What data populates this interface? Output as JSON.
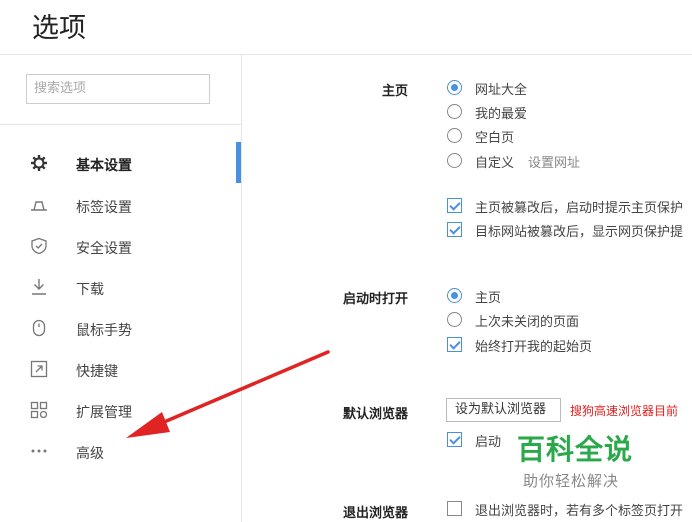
{
  "page": {
    "title": "选项"
  },
  "search": {
    "placeholder": "搜索选项"
  },
  "sidebar": {
    "items": [
      {
        "label": "基本设置",
        "icon": "gear-icon"
      },
      {
        "label": "标签设置",
        "icon": "tab-icon"
      },
      {
        "label": "安全设置",
        "icon": "shield-icon"
      },
      {
        "label": "下载",
        "icon": "download-icon"
      },
      {
        "label": "鼠标手势",
        "icon": "mouse-icon"
      },
      {
        "label": "快捷键",
        "icon": "shortcut-icon"
      },
      {
        "label": "扩展管理",
        "icon": "extensions-icon"
      },
      {
        "label": "高级",
        "icon": "more-dots-icon"
      }
    ],
    "active_index": 0
  },
  "homepage": {
    "label": "主页",
    "options": [
      "网址大全",
      "我的最爱",
      "空白页",
      "自定义"
    ],
    "selected": 0,
    "set_url_link": "设置网址",
    "checks": [
      {
        "label": "主页被篡改后，启动时提示主页保护",
        "checked": true
      },
      {
        "label": "目标网站被篡改后，显示网页保护提",
        "checked": true
      }
    ]
  },
  "startup": {
    "label": "启动时打开",
    "options": [
      "主页",
      "上次未关闭的页面"
    ],
    "selected": 0,
    "check": {
      "label": "始终打开我的起始页",
      "checked": true
    }
  },
  "default_browser": {
    "label": "默认浏览器",
    "button": "设为默认浏览器",
    "note": "搜狗高速浏览器目前",
    "check": {
      "label": "启动",
      "checked": true
    }
  },
  "exit_browser": {
    "label": "退出浏览器",
    "check": {
      "label": "退出浏览器时，若有多个标签页打开",
      "checked": false
    }
  },
  "watermark": {
    "line1": "百科全说",
    "line2": "助你轻松解决"
  },
  "colors": {
    "accent": "#4a90e2",
    "arrow": "#e02424",
    "watermark": "#2aa84a"
  }
}
